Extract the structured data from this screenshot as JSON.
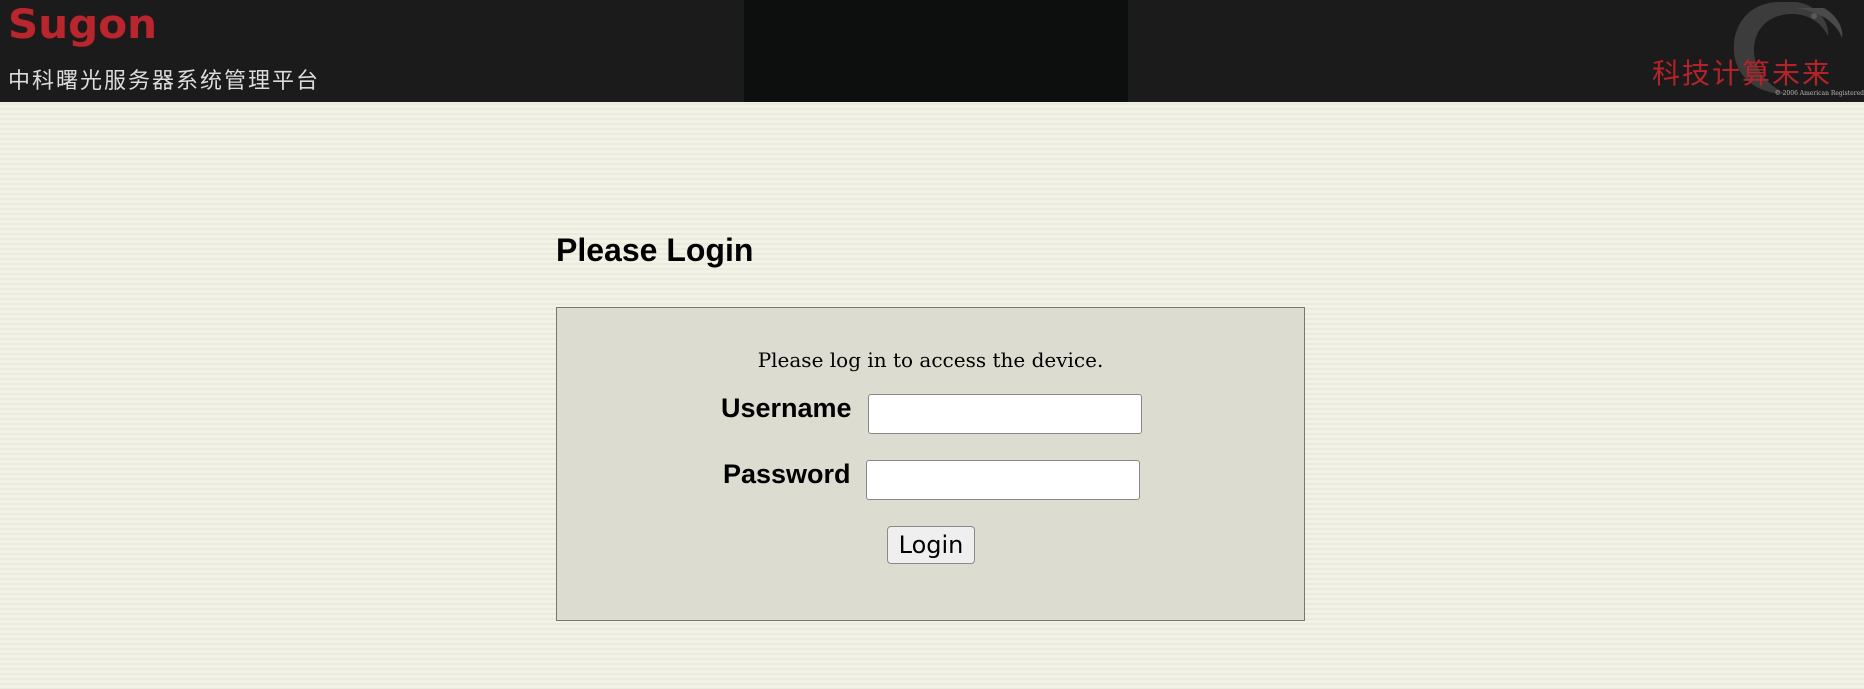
{
  "header": {
    "brand": "Sugon",
    "platform_title": "中科曙光服务器系统管理平台",
    "slogan": "科技计算未来",
    "copyright": "© 2006 American Registered"
  },
  "login": {
    "heading": "Please Login",
    "message": "Please log in to access the device.",
    "username_label": "Username",
    "username_value": "",
    "password_label": "Password",
    "password_value": "",
    "submit_label": "Login"
  },
  "colors": {
    "brand_red": "#b8262e",
    "header_bg": "#1b1b1b",
    "page_bg": "#f2f1e5",
    "panel_bg": "#dddcd0"
  }
}
